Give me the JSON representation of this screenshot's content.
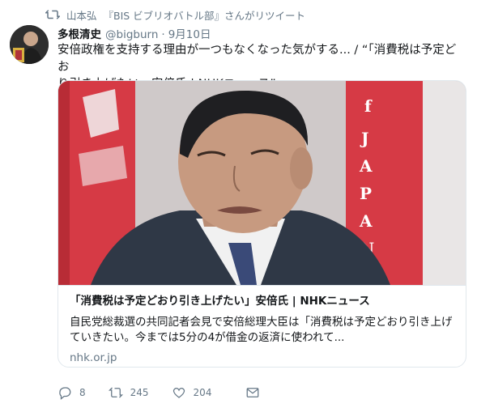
{
  "retweet": {
    "icon": "retweet-icon",
    "by": "山本弘",
    "label": "『BIS ビブリオバトル部』さんがリツイート"
  },
  "tweet": {
    "display_name": "多根清史",
    "handle": "@bigburn",
    "separator": "·",
    "date": "9月10日",
    "text_line1": "安倍政権を支持する理由が一つもなくなった気がする... / “「消費税は予定どお",
    "text_line2": "り引き上げたい」安倍氏 | NHKニュース”"
  },
  "card": {
    "image_alt": "news-photo",
    "title": "「消費税は予定どおり引き上げたい」安倍氏 | NHKニュース",
    "description": "自民党総裁選の共同記者会見で安倍総理大臣は「消費税は予定どおり引き上げていきたい。今までは5分の4が借金の返済に使われて...",
    "domain": "nhk.or.jp"
  },
  "actions": {
    "reply_icon": "reply-icon",
    "reply_count": "8",
    "retweet_icon": "retweet-icon",
    "retweet_count": "245",
    "like_icon": "heart-icon",
    "like_count": "204",
    "dm_icon": "envelope-icon"
  },
  "colors": {
    "text": "#14171a",
    "muted": "#657786",
    "border": "#e1e8ed",
    "banner_red": "#d63a45"
  }
}
